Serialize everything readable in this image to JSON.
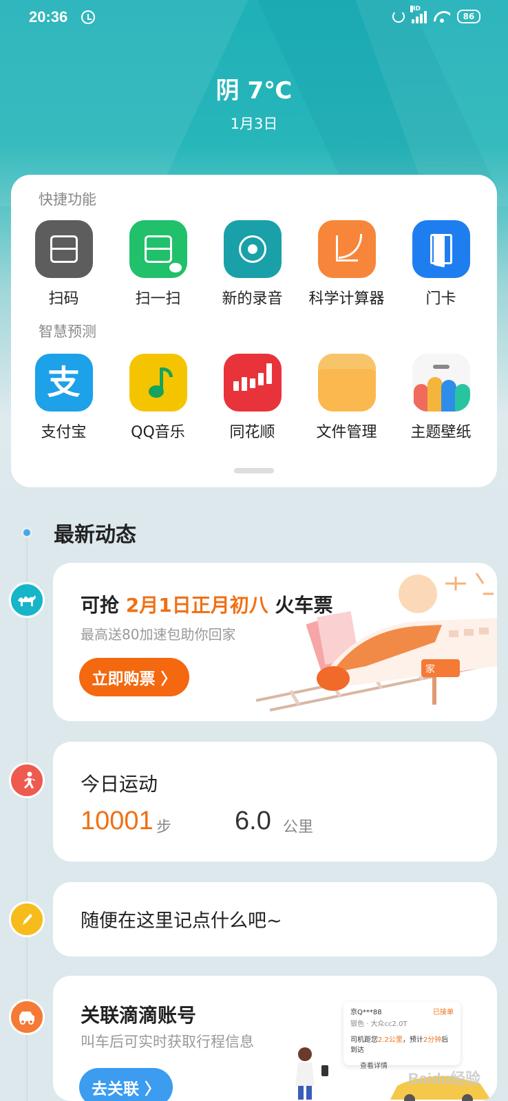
{
  "status": {
    "time": "20:36",
    "network": "HD",
    "battery": "86"
  },
  "header": {
    "weather": "阴 7℃",
    "date": "1月3日"
  },
  "quick": {
    "label": "快捷功能",
    "apps": [
      {
        "label": "扫码",
        "icon": "scan-icon"
      },
      {
        "label": "扫一扫",
        "icon": "wechat-scan-icon"
      },
      {
        "label": "新的录音",
        "icon": "recorder-icon"
      },
      {
        "label": "科学计算器",
        "icon": "calculator-icon"
      },
      {
        "label": "门卡",
        "icon": "door-card-icon"
      }
    ]
  },
  "smart": {
    "label": "智慧预测",
    "apps": [
      {
        "label": "支付宝",
        "icon": "alipay-icon",
        "glyph": "支"
      },
      {
        "label": "QQ音乐",
        "icon": "qq-music-icon"
      },
      {
        "label": "同花顺",
        "icon": "tonghuashun-icon"
      },
      {
        "label": "文件管理",
        "icon": "file-manager-icon"
      },
      {
        "label": "主题壁纸",
        "icon": "theme-icon"
      }
    ]
  },
  "feed": {
    "title": "最新动态",
    "train": {
      "prefix": "可抢 ",
      "highlight": "2月1日正月初八",
      "suffix": " 火车票",
      "subtitle": "最高送80加速包助你回家",
      "button": "立即购票 〉",
      "sign": "家",
      "icon": "camel-icon"
    },
    "sport": {
      "title": "今日运动",
      "steps": "10001",
      "steps_unit": "步",
      "distance": "6.0",
      "distance_unit": "公里",
      "icon": "running-icon"
    },
    "note": {
      "text": "随便在这里记点什么吧~",
      "icon": "pencil-icon"
    },
    "didi": {
      "title": "关联滴滴账号",
      "subtitle": "叫车后可实时获取行程信息",
      "button": "去关联 〉",
      "icon": "car-icon",
      "preview": {
        "plate": "京Q***88",
        "status": "已接单",
        "car": "银色 · 大众cc2.0T",
        "info_prefix": "司机距您",
        "distance": "2.2公里",
        "info_mid": "，预计",
        "eta": "2分钟",
        "info_suffix": "后到达",
        "detail": "查看详情"
      }
    }
  },
  "watermark": "Baidu经验",
  "colors": {
    "accent": "#f07015",
    "teal": "#1fb0b8",
    "blue_button": "#3b9cf0"
  }
}
